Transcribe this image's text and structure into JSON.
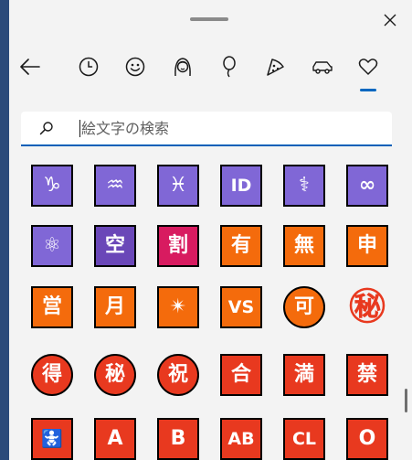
{
  "window": {
    "close_symbol": "×"
  },
  "search": {
    "placeholder": "絵文字の検索",
    "value": ""
  },
  "nav": [
    {
      "id": "back",
      "icon": "back-arrow-icon"
    },
    {
      "id": "recent",
      "icon": "clock-icon"
    },
    {
      "id": "smileys",
      "icon": "smiley-icon"
    },
    {
      "id": "people",
      "icon": "person-icon"
    },
    {
      "id": "celebration",
      "icon": "balloon-icon"
    },
    {
      "id": "food",
      "icon": "pizza-icon"
    },
    {
      "id": "travel",
      "icon": "car-icon"
    },
    {
      "id": "symbols",
      "icon": "heart-icon",
      "active": true
    }
  ],
  "emoji_rows": [
    [
      {
        "label": "♑",
        "bg": "#8067d6",
        "shape": "square"
      },
      {
        "label": "♒",
        "bg": "#8067d6",
        "shape": "square"
      },
      {
        "label": "♓",
        "bg": "#8067d6",
        "shape": "square"
      },
      {
        "label": "ID",
        "bg": "#8067d6",
        "shape": "square"
      },
      {
        "label": "⚕",
        "bg": "#8067d6",
        "shape": "square"
      },
      {
        "label": "∞",
        "bg": "#8067d6",
        "shape": "square"
      }
    ],
    [
      {
        "label": "⚛",
        "bg": "#8067d6",
        "shape": "square"
      },
      {
        "label": "空",
        "bg": "#6a47b8",
        "shape": "square"
      },
      {
        "label": "割",
        "bg": "#d81b60",
        "shape": "square"
      },
      {
        "label": "有",
        "bg": "#f46b0c",
        "shape": "square"
      },
      {
        "label": "無",
        "bg": "#f46b0c",
        "shape": "square"
      },
      {
        "label": "申",
        "bg": "#f46b0c",
        "shape": "square"
      }
    ],
    [
      {
        "label": "営",
        "bg": "#f46b0c",
        "shape": "square"
      },
      {
        "label": "月",
        "bg": "#f46b0c",
        "shape": "square"
      },
      {
        "label": "✴",
        "bg": "#f46b0c",
        "shape": "square"
      },
      {
        "label": "VS",
        "bg": "#f46b0c",
        "shape": "square"
      },
      {
        "label": "可",
        "bg": "#f46b0c",
        "shape": "circle"
      },
      {
        "label": "㊙",
        "bg": "#ffffff",
        "shape": "badge"
      }
    ],
    [
      {
        "label": "得",
        "bg": "#e8391f",
        "shape": "circle"
      },
      {
        "label": "秘",
        "bg": "#e8391f",
        "shape": "circle"
      },
      {
        "label": "祝",
        "bg": "#e8391f",
        "shape": "circle"
      },
      {
        "label": "合",
        "bg": "#e8391f",
        "shape": "square"
      },
      {
        "label": "満",
        "bg": "#e8391f",
        "shape": "square"
      },
      {
        "label": "禁",
        "bg": "#e8391f",
        "shape": "square"
      }
    ],
    [
      {
        "label": "🚼",
        "bg": "#e8391f",
        "shape": "square"
      },
      {
        "label": "A",
        "bg": "#e8391f",
        "shape": "square"
      },
      {
        "label": "B",
        "bg": "#e8391f",
        "shape": "square"
      },
      {
        "label": "AB",
        "bg": "#e8391f",
        "shape": "square"
      },
      {
        "label": "CL",
        "bg": "#e8391f",
        "shape": "square"
      },
      {
        "label": "O",
        "bg": "#e8391f",
        "shape": "square"
      }
    ]
  ]
}
